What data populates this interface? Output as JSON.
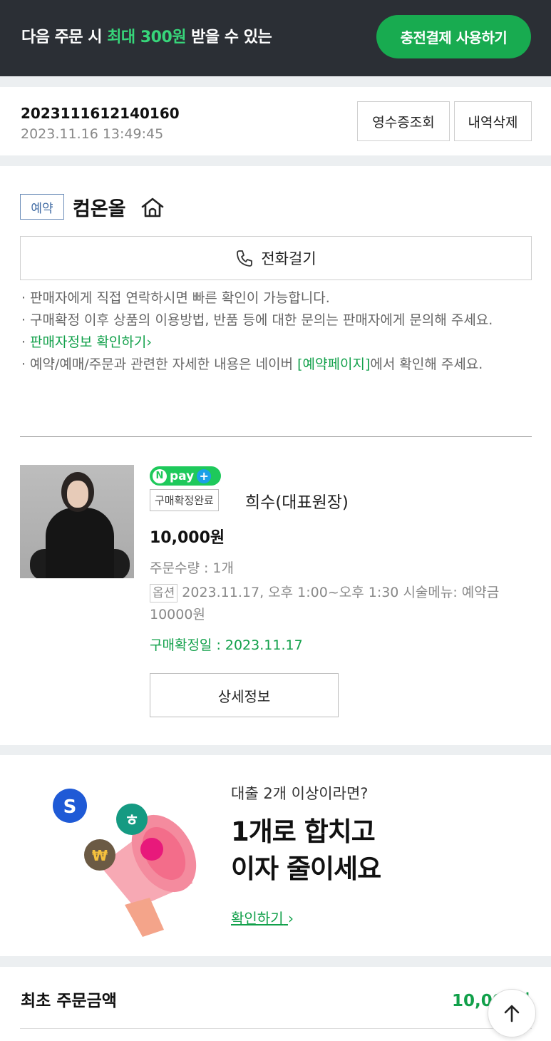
{
  "banner": {
    "text_before": "다음 주문 시 ",
    "text_highlight": "최대 300원",
    "text_after": " 받을 수 있는",
    "button": "충전결제 사용하기"
  },
  "order": {
    "number": "2023111612140160",
    "datetime": "2023.11.16 13:49:45",
    "receipt_button": "영수증조회",
    "delete_button": "내역삭제"
  },
  "store": {
    "badge": "예약",
    "name": "컴온올",
    "call_button": "전화걸기",
    "notes": {
      "line1": "판매자에게 직접 연락하시면 빠른 확인이 가능합니다.",
      "line2": "구매확정 이후 상품의 이용방법, 반품 등에 대한 문의는 판매자에게 문의해 주세요.",
      "seller_link": "판매자정보 확인하기",
      "line4_before": "예약/예매/주문과 관련한 자세한 내용은 네이버 ",
      "line4_link": "[예약페이지]",
      "line4_after": "에서 확인해 주세요."
    }
  },
  "product": {
    "pay_badge": "pay",
    "status": "구매확정완료",
    "name": "희수(대표원장)",
    "price": "10,000원",
    "quantity": "주문수량 : 1개",
    "option_label": "옵션",
    "option_text": "2023.11.17, 오후 1:00~오후 1:30 시술메뉴: 예약금 10000원",
    "confirm_date": "구매확정일 : 2023.11.17",
    "detail_button": "상세정보"
  },
  "ad": {
    "subtitle": "대출 2개 이상이라면?",
    "title_line1": "1개로 합치고",
    "title_line2": "이자 줄이세요",
    "link": "확인하기"
  },
  "total": {
    "label": "최초 주문금액",
    "amount": "10,000원"
  },
  "colors": {
    "brand_green": "#18ab50",
    "text_green": "#11a04a",
    "banner_bg": "#2b2f35"
  }
}
